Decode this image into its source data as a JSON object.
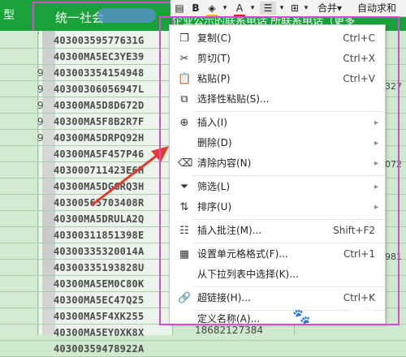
{
  "header": {
    "left": "型",
    "title": "统一社会",
    "right": "企业公示的联系电话 所联系电话（更多"
  },
  "toolbar": {
    "bold": "B",
    "font_color": "A",
    "merge": "合并▾",
    "autosum": "自动求和"
  },
  "rows": [
    "40300359577631G",
    "40300MA5EC3YE39",
    "403003354154948",
    "403003060569​47L",
    "40300MA5D8D672D",
    "40300MA5F8B2R7F",
    "40300MA5DRPQ92H",
    "40300MA5F457P46",
    "403000711423E6H",
    "40300MA5DGGRQ3H",
    "403005657034​08R",
    "40300MA5DRULA2Q",
    "403003118513​98E",
    "40300335320014A",
    "40300335193828U",
    "40300MA5EM0C80K",
    "40300MA5EC47Q25",
    "40300MA5F4XK255",
    "40300MA5EY0XK8X",
    "40300359478922A"
  ],
  "left_nums": [
    "9",
    "9",
    "9",
    "9",
    "9"
  ],
  "right_peeks": [
    "327",
    "072",
    "981"
  ],
  "bottom_peek": "18682127384",
  "menu": {
    "items": [
      {
        "icon": "copy-icon",
        "label": "复制(C)",
        "shortcut": "Ctrl+C"
      },
      {
        "icon": "cut-icon",
        "label": "剪切(T)",
        "shortcut": "Ctrl+X"
      },
      {
        "icon": "paste-icon",
        "label": "粘贴(P)",
        "shortcut": "Ctrl+V"
      },
      {
        "icon": "paste-special-icon",
        "label": "选择性粘贴(S)...",
        "shortcut": ""
      },
      {
        "icon": "insert-icon",
        "label": "插入(I)",
        "shortcut": ""
      },
      {
        "icon": "",
        "label": "删除(D)",
        "shortcut": ""
      },
      {
        "icon": "eraser-icon",
        "label": "清除内容(N)",
        "shortcut": ""
      },
      {
        "icon": "filter-icon",
        "label": "筛选(L)",
        "shortcut": ""
      },
      {
        "icon": "sort-icon",
        "label": "排序(U)",
        "shortcut": ""
      },
      {
        "icon": "comment-icon",
        "label": "插入批注(M)...",
        "shortcut": "Shift+F2"
      },
      {
        "icon": "format-cells-icon",
        "label": "设置单元格格式(F)...",
        "shortcut": "Ctrl+1"
      },
      {
        "icon": "",
        "label": "从下拉列表中选择(K)...",
        "shortcut": ""
      },
      {
        "icon": "link-icon",
        "label": "超链接(H)...",
        "shortcut": "Ctrl+K"
      },
      {
        "icon": "",
        "label": "定义名称(A)...",
        "shortcut": ""
      }
    ]
  },
  "watermark": "Bai 经验",
  "colors": {
    "header_green": "#19a23a",
    "highlight": "#d64ad6",
    "arrow": "#e23b2e"
  }
}
